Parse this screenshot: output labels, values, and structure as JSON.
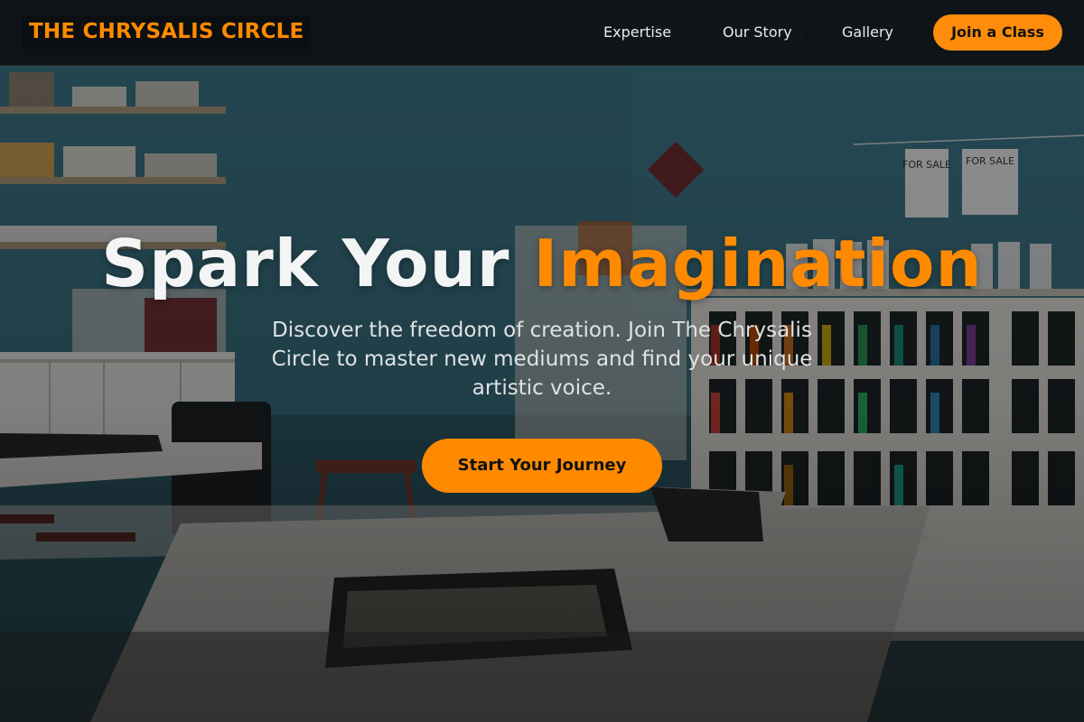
{
  "brand": {
    "name": "THE CHRYSALIS CIRCLE",
    "accent_color": "#ff8a00"
  },
  "nav": {
    "links": [
      {
        "label": "Expertise"
      },
      {
        "label": "Our Story"
      },
      {
        "label": "Gallery"
      }
    ],
    "cta_label": "Join a Class"
  },
  "hero": {
    "title_main": "Spark Your",
    "title_accent": "Imagination",
    "subtitle": "Discover the freedom of creation. Join The Chrysalis Circle to master new mediums and find your unique artistic voice.",
    "cta_label": "Start Your Journey",
    "background_sign_text": "FOR SALE"
  }
}
